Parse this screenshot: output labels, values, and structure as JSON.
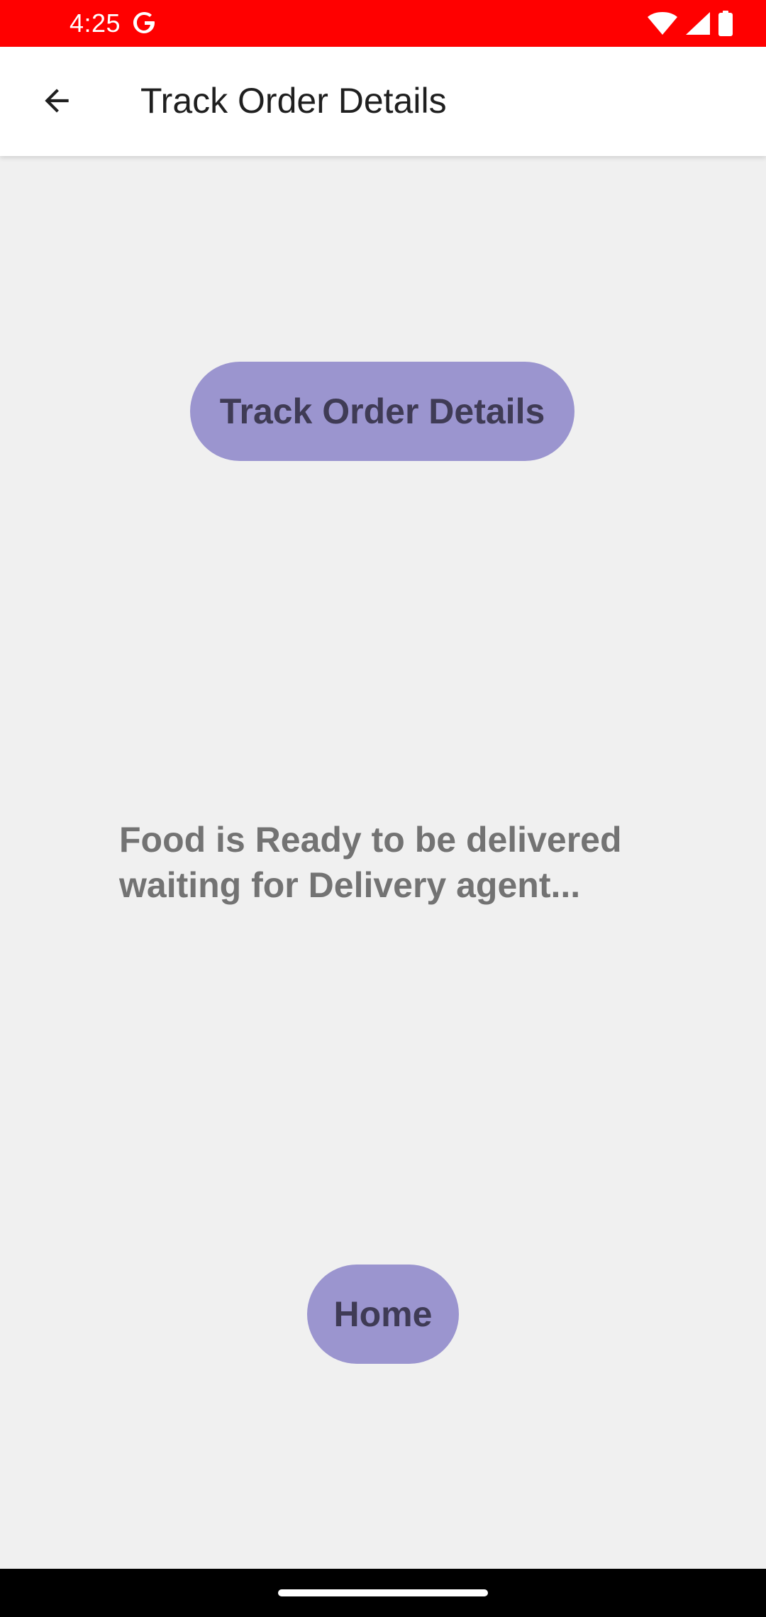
{
  "status_bar": {
    "time": "4:25",
    "background_color": "#ff0000",
    "icons": [
      "google-g-icon",
      "wifi-icon",
      "cellular-signal-icon",
      "battery-icon"
    ]
  },
  "app_bar": {
    "title": "Track Order Details",
    "back_icon": "arrow-back-icon"
  },
  "main": {
    "track_button_label": "Track Order Details",
    "status_message": "Food is Ready to be delivered\nwaiting for Delivery agent...",
    "home_button_label": "Home",
    "button_color": "#9b95cf"
  },
  "nav_bar": {
    "indicator": "home-indicator"
  }
}
